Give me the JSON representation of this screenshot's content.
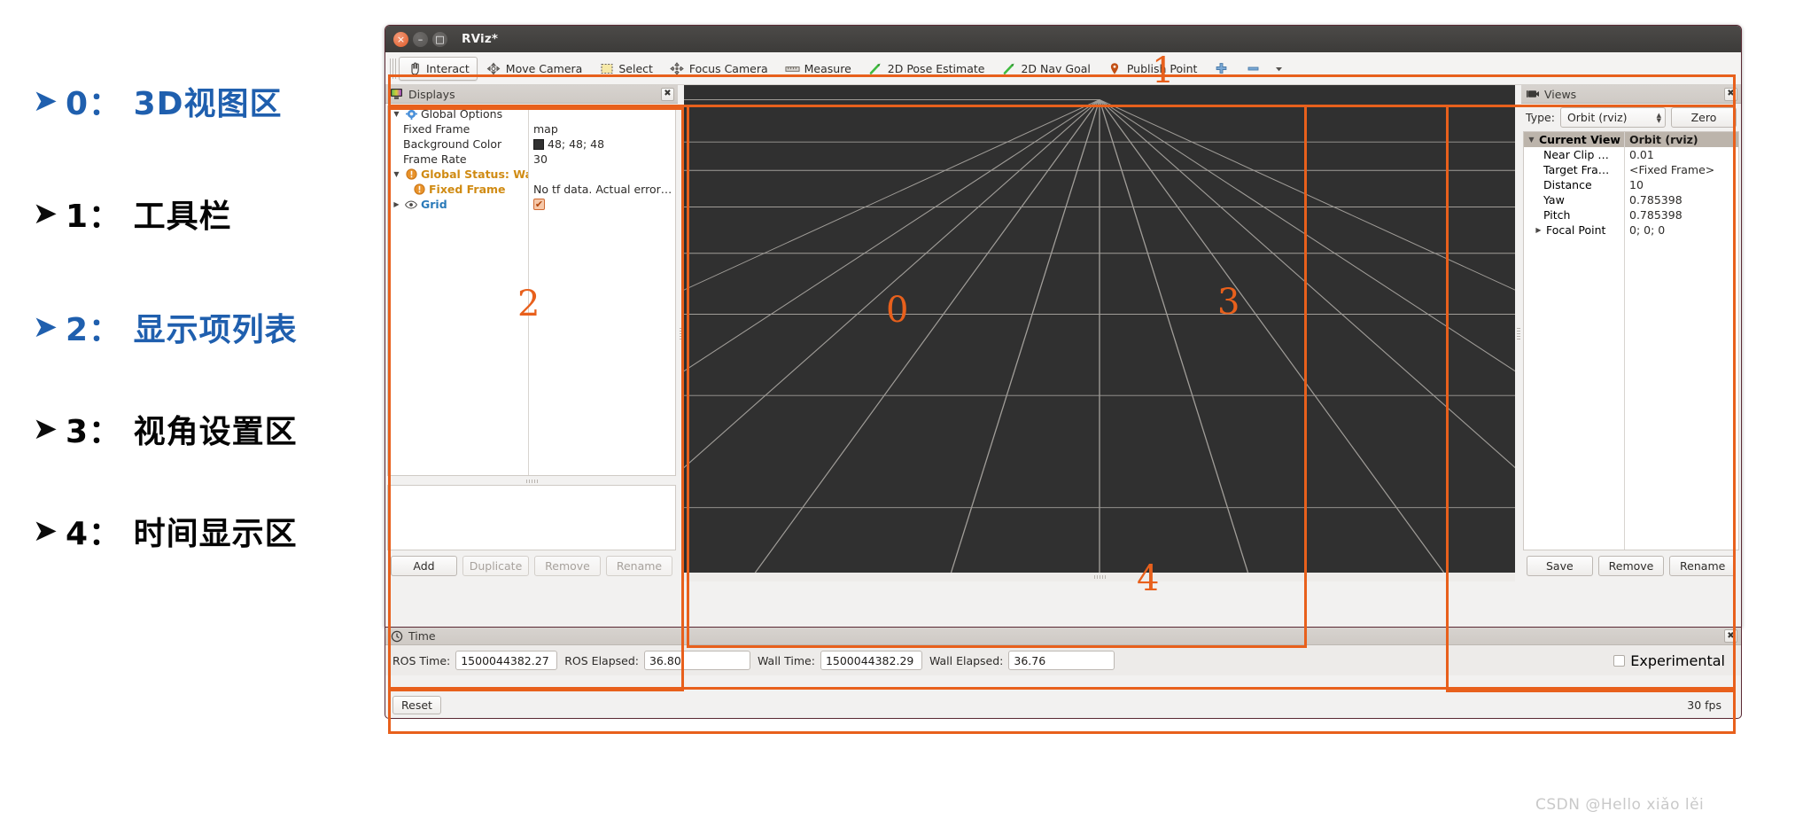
{
  "legend": {
    "items": [
      {
        "arrow": "arrow-bullet",
        "num": "0",
        "sep": "：",
        "text": "3D视图区",
        "color": "blue"
      },
      {
        "arrow": "arrow-bullet",
        "num": "1",
        "sep": "：",
        "text": "工具栏",
        "color": "black"
      },
      {
        "arrow": "arrow-bullet",
        "num": "2",
        "sep": "：",
        "text": "显示项列表",
        "color": "blue"
      },
      {
        "arrow": "arrow-bullet",
        "num": "3",
        "sep": "：",
        "text": "视角设置区",
        "color": "black"
      },
      {
        "arrow": "arrow-bullet",
        "num": "4",
        "sep": "：",
        "text": "时间显示区",
        "color": "black"
      }
    ],
    "full": [
      "0： 3D视图区",
      "1： 工具栏",
      "2： 显示项列表",
      "3： 视角设置区",
      "4： 时间显示区"
    ]
  },
  "window": {
    "title": "RViz*",
    "buttons": {
      "close": "×",
      "minimize": "–",
      "maximize": "□"
    }
  },
  "toolbar": {
    "items": [
      {
        "label": "Interact",
        "icon": "hand-cursor-icon",
        "active": true
      },
      {
        "label": "Move Camera",
        "icon": "move-camera-icon",
        "active": false
      },
      {
        "label": "Select",
        "icon": "select-box-icon",
        "active": false
      },
      {
        "label": "Focus Camera",
        "icon": "focus-camera-icon",
        "active": false
      },
      {
        "label": "Measure",
        "icon": "ruler-icon",
        "active": false
      },
      {
        "label": "2D Pose Estimate",
        "icon": "green-arrow-icon",
        "active": false
      },
      {
        "label": "2D Nav Goal",
        "icon": "green-arrow-icon",
        "active": false
      },
      {
        "label": "Publish Point",
        "icon": "map-pin-icon",
        "active": false
      }
    ],
    "extra": [
      {
        "label": "",
        "icon": "plus-icon"
      },
      {
        "label": "",
        "icon": "minus-icon"
      },
      {
        "label": "",
        "icon": "chevron-down-icon"
      }
    ]
  },
  "displays": {
    "panel_title": "Displays",
    "close": "✖",
    "rows": [
      {
        "indent": 0,
        "twisty": "▼",
        "icon": "gear-icon",
        "label": "Global Options",
        "style": "normal",
        "value": "",
        "value_kind": "text"
      },
      {
        "indent": 1,
        "twisty": "",
        "icon": "",
        "label": "Fixed Frame",
        "style": "normal",
        "value": "map",
        "value_kind": "text"
      },
      {
        "indent": 1,
        "twisty": "",
        "icon": "",
        "label": "Background Color",
        "style": "normal",
        "value": "48; 48; 48",
        "value_kind": "swatch"
      },
      {
        "indent": 1,
        "twisty": "",
        "icon": "",
        "label": "Frame Rate",
        "style": "normal",
        "value": "30",
        "value_kind": "text"
      },
      {
        "indent": 0,
        "twisty": "▼",
        "icon": "warning-icon",
        "label": "Global Status: Warn",
        "style": "warn",
        "value": "",
        "value_kind": "text"
      },
      {
        "indent": 1,
        "twisty": "",
        "icon": "warning-icon",
        "label": "Fixed Frame",
        "style": "warn",
        "value": "No tf data.  Actual error…",
        "value_kind": "text"
      },
      {
        "indent": 0,
        "twisty": "▶",
        "icon": "eye-icon",
        "label": "Grid",
        "style": "link",
        "value": "",
        "value_kind": "check"
      }
    ],
    "buttons": [
      {
        "label": "Add",
        "enabled": true
      },
      {
        "label": "Duplicate",
        "enabled": false
      },
      {
        "label": "Remove",
        "enabled": false
      },
      {
        "label": "Rename",
        "enabled": false
      }
    ]
  },
  "views": {
    "panel_title": "Views",
    "close": "✖",
    "type_label": "Type:",
    "type_value": "Orbit (rviz)",
    "zero_label": "Zero",
    "rows": [
      {
        "twisty": "▼",
        "indent": 0,
        "label": "Current View",
        "value": "Orbit (rviz)",
        "selected": true
      },
      {
        "twisty": "",
        "indent": 1,
        "label": "Near Clip …",
        "value": "0.01",
        "selected": false
      },
      {
        "twisty": "",
        "indent": 1,
        "label": "Target Fra…",
        "value": "<Fixed Frame>",
        "selected": false
      },
      {
        "twisty": "",
        "indent": 1,
        "label": "Distance",
        "value": "10",
        "selected": false
      },
      {
        "twisty": "",
        "indent": 1,
        "label": "Yaw",
        "value": "0.785398",
        "selected": false
      },
      {
        "twisty": "",
        "indent": 1,
        "label": "Pitch",
        "value": "0.785398",
        "selected": false
      },
      {
        "twisty": "▶",
        "indent": 1,
        "label": "Focal Point",
        "value": "0; 0; 0",
        "selected": false
      }
    ],
    "buttons": [
      {
        "label": "Save",
        "enabled": true
      },
      {
        "label": "Remove",
        "enabled": true
      },
      {
        "label": "Rename",
        "enabled": true
      }
    ]
  },
  "time": {
    "panel_title": "Time",
    "close": "✖",
    "fields": [
      {
        "label": "ROS Time:",
        "value": "1500044382.27"
      },
      {
        "label": "ROS Elapsed:",
        "value": "36.80"
      },
      {
        "label": "Wall Time:",
        "value": "1500044382.29"
      },
      {
        "label": "Wall Elapsed:",
        "value": "36.76"
      }
    ],
    "experimental_label": "Experimental",
    "experimental_checked": false
  },
  "statusbar": {
    "reset_label": "Reset",
    "fps": "30 fps"
  },
  "annotations": {
    "accent": "#E8601C",
    "labels": {
      "n0": "0",
      "n1": "1",
      "n2": "2",
      "n3": "3",
      "n4": "4"
    }
  },
  "viewport": {
    "background_color": "#303030",
    "grid_color": "#b4b0ab",
    "center_marker": "0"
  },
  "watermark": "CSDN @Hello xiǎo lěi"
}
